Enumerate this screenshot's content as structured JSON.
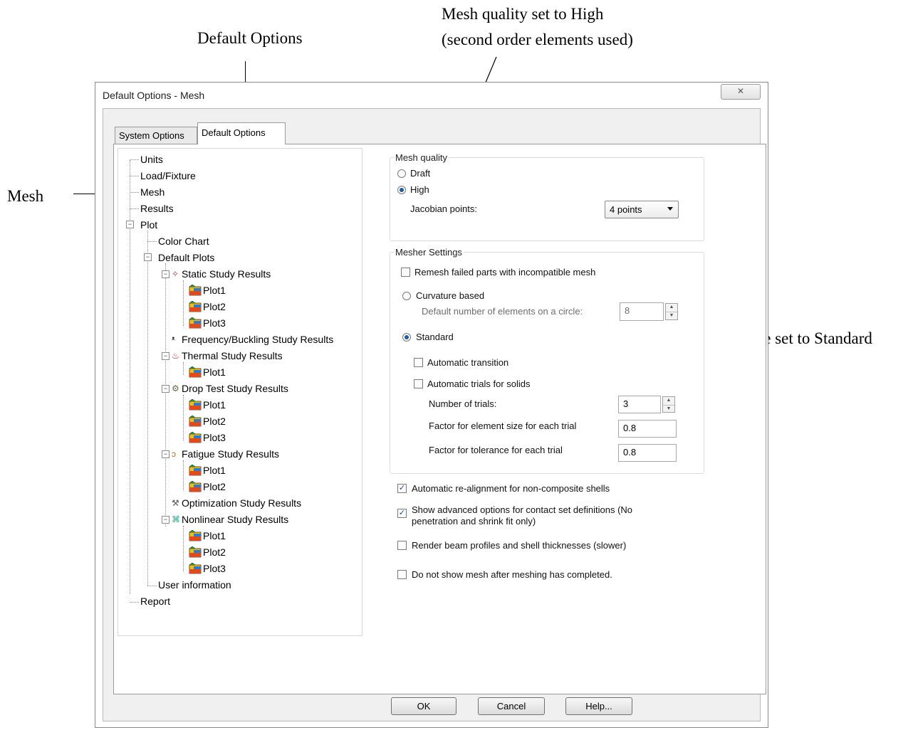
{
  "annotations": {
    "default_options": "Default Options",
    "mesh_quality_line1": "Mesh quality set to High",
    "mesh_quality_line2": "(second order elements used)",
    "mesh": "Mesh",
    "mesh_type": "Mesh type set to Standard"
  },
  "dialog": {
    "title": "Default Options - Mesh",
    "close_glyph": "✕",
    "tabs": [
      "System Options",
      "Default Options"
    ],
    "active_tab": "Default Options"
  },
  "tree": {
    "items": [
      "Units",
      "Load/Fixture",
      "Mesh",
      "Results",
      "Plot",
      "Color Chart",
      "Default Plots",
      "Static Study Results",
      "Plot1",
      "Plot2",
      "Plot3",
      "Frequency/Buckling Study Results",
      "Thermal Study Results",
      "Plot1",
      "Drop Test Study Results",
      "Plot1",
      "Plot2",
      "Plot3",
      "Fatigue Study Results",
      "Plot1",
      "Plot2",
      "Optimization Study Results",
      "Nonlinear Study Results",
      "Plot1",
      "Plot2",
      "Plot3",
      "User information",
      "Report"
    ]
  },
  "mesh_quality": {
    "legend": "Mesh quality",
    "draft": "Draft",
    "high": "High",
    "selected": "High",
    "jacobian_label": "Jacobian points:",
    "jacobian_value": "4 points"
  },
  "mesher_settings": {
    "legend": "Mesher Settings",
    "remesh": "Remesh failed parts with incompatible mesh",
    "curvature": "Curvature based",
    "default_elements_label": "Default number of elements on a circle:",
    "default_elements_value": "8",
    "standard": "Standard",
    "selected": "Standard",
    "auto_transition": "Automatic transition",
    "auto_trials": "Automatic trials for solids",
    "num_trials_label": "Number of trials:",
    "num_trials_value": "3",
    "factor_size_label": "Factor for element size for each trial",
    "factor_size_value": "0.8",
    "factor_tol_label": "Factor for tolerance for each trial",
    "factor_tol_value": "0.8"
  },
  "options": {
    "realign": "Automatic re-alignment for non-composite shells",
    "realign_checked": true,
    "advanced_line1": "Show advanced options for contact set definitions (No",
    "advanced_line2": "penetration and shrink fit only)",
    "advanced_checked": true,
    "render_beam": "Render beam profiles and shell thicknesses (slower)",
    "render_checked": false,
    "no_mesh": "Do not show mesh after meshing has completed.",
    "no_mesh_checked": false
  },
  "buttons": {
    "ok": "OK",
    "cancel": "Cancel",
    "help": "Help..."
  },
  "colors": {
    "accent": "#1d5aa8",
    "check": "#1d4a8a"
  }
}
